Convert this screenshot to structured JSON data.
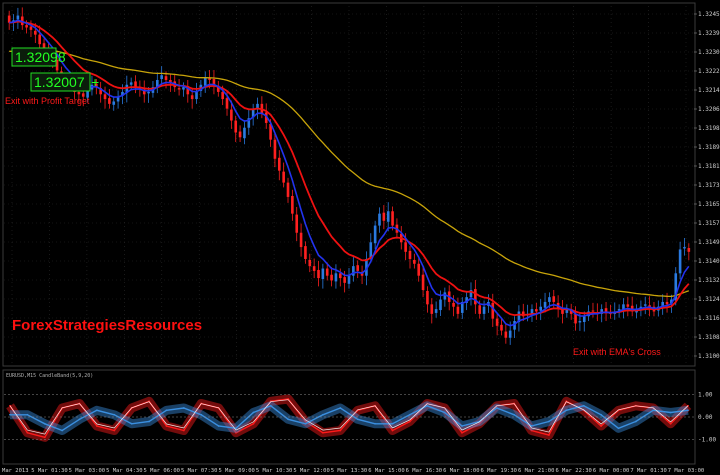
{
  "chart_data": [
    {
      "type": "candlestick",
      "brand": "ForexStrategiesResources",
      "annotations": {
        "exit_profit": "Exit with Profit Target",
        "exit_ema": "Exit with  EMA's Cross"
      },
      "price_boxes": [
        "1.32098",
        "1.32007"
      ],
      "ylim": [
        1.3095,
        1.3245
      ],
      "y_ticks": [
        "1.32450",
        "1.32390",
        "1.32305",
        "1.32225",
        "1.32140",
        "1.32060",
        "1.31980",
        "1.31895",
        "1.31815",
        "1.31735",
        "1.31650",
        "1.31570",
        "1.31490",
        "1.31405",
        "1.31325",
        "1.31245",
        "1.31165",
        "1.31080",
        "1.31000"
      ],
      "x_ticks": [
        "5 Mar 2013",
        "5 Mar 01:30",
        "5 Mar 03:00",
        "5 Mar 04:30",
        "5 Mar 06:00",
        "5 Mar 07:30",
        "5 Mar 09:00",
        "5 Mar 10:30",
        "5 Mar 12:00",
        "5 Mar 13:30",
        "6 Mar 15:00",
        "6 Mar 16:30",
        "6 Mar 18:00",
        "6 Mar 19:30",
        "6 Mar 21:00",
        "6 Mar 22:30",
        "6 Mar 00:00",
        "7 Mar 01:30",
        "7 Mar 03:00"
      ],
      "close": [
        1.3238,
        1.3239,
        1.3241,
        1.3237,
        1.3236,
        1.3235,
        1.3233,
        1.3229,
        1.3227,
        1.3224,
        1.3222,
        1.3218,
        1.3214,
        1.3213,
        1.3212,
        1.3209,
        1.3208,
        1.3207,
        1.321,
        1.3212,
        1.3211,
        1.3208,
        1.3206,
        1.3204,
        1.3205,
        1.3207,
        1.3209,
        1.3212,
        1.3213,
        1.3211,
        1.321,
        1.3208,
        1.3209,
        1.3211,
        1.3214,
        1.3216,
        1.3214,
        1.3213,
        1.3211,
        1.321,
        1.3211,
        1.3208,
        1.3206,
        1.3209,
        1.3212,
        1.3215,
        1.3214,
        1.3212,
        1.3209,
        1.3206,
        1.3202,
        1.3197,
        1.3192,
        1.319,
        1.3194,
        1.3198,
        1.3202,
        1.3204,
        1.32,
        1.3196,
        1.3189,
        1.3181,
        1.3176,
        1.3171,
        1.3165,
        1.3158,
        1.315,
        1.3144,
        1.3139,
        1.3136,
        1.3134,
        1.3131,
        1.3135,
        1.3132,
        1.313,
        1.3133,
        1.3131,
        1.3129,
        1.3132,
        1.3136,
        1.3134,
        1.3132,
        1.3139,
        1.3146,
        1.3153,
        1.3158,
        1.3155,
        1.3159,
        1.3153,
        1.315,
        1.3146,
        1.3142,
        1.3139,
        1.3137,
        1.3132,
        1.3126,
        1.312,
        1.3116,
        1.3118,
        1.3122,
        1.3125,
        1.3121,
        1.3119,
        1.3116,
        1.3121,
        1.3123,
        1.3126,
        1.312,
        1.3116,
        1.3119,
        1.3121,
        1.3114,
        1.3111,
        1.3109,
        1.3106,
        1.3109,
        1.3113,
        1.3117,
        1.3115,
        1.3116,
        1.3118,
        1.3117,
        1.3119,
        1.3121,
        1.3123,
        1.3121,
        1.3118,
        1.3116,
        1.3118,
        1.3116,
        1.3112,
        1.3113,
        1.3115,
        1.3117,
        1.3117,
        1.3116,
        1.3118,
        1.3117,
        1.3116,
        1.3117,
        1.3118,
        1.312,
        1.3119,
        1.3117,
        1.3118,
        1.3119,
        1.312,
        1.3119,
        1.3117,
        1.3119,
        1.3121,
        1.312,
        1.3122,
        1.3133,
        1.3143,
        1.3144,
        1.3142
      ]
    },
    {
      "type": "line",
      "title": "EURUSD,M15  CandleBand(5,9,20)",
      "ylim": [
        -2,
        2
      ],
      "y_ticks": [
        "1.00",
        "0.00",
        "-1.00"
      ],
      "levels": [
        1,
        0,
        -1
      ],
      "series": [
        {
          "color": "#ff1a1a",
          "values": [
            0.5,
            -0.7,
            -0.9,
            0.4,
            0.6,
            -0.4,
            -0.6,
            0.4,
            0.7,
            -0.4,
            -0.6,
            0.6,
            0.4,
            -0.7,
            -0.3,
            0.7,
            0.8,
            -0.2,
            -0.7,
            -0.6,
            0.3,
            0.5,
            -0.6,
            -0.2,
            0.6,
            0.4,
            -0.7,
            -0.3,
            0.5,
            0.6,
            -0.6,
            -0.8,
            0.7,
            0.3,
            -0.4,
            0.3,
            0.5,
            0.4,
            -0.3,
            0.5
          ]
        },
        {
          "color": "#3a8fe0",
          "values": [
            0.1,
            0.1,
            -0.3,
            -0.6,
            -0.1,
            0.3,
            0.1,
            -0.3,
            -0.2,
            0.3,
            0.4,
            0.1,
            -0.4,
            -0.5,
            0.2,
            0.5,
            -0.1,
            -0.3,
            0.1,
            0.4,
            -0.1,
            -0.3,
            -0.3,
            0.1,
            0.5,
            0.2,
            -0.4,
            -0.2,
            0.4,
            0.1,
            -0.4,
            -0.2,
            0.3,
            0.5,
            0.1,
            -0.5,
            -0.2,
            0.3,
            0.2,
            0.3
          ]
        }
      ]
    }
  ],
  "colors": {
    "bull": "#2a7ae0",
    "bear": "#ff2020",
    "ema_fast": "#2233ee",
    "ema_mid": "#ee1111",
    "ema_slow": "#c8a40a",
    "grid": "#ffffff"
  }
}
